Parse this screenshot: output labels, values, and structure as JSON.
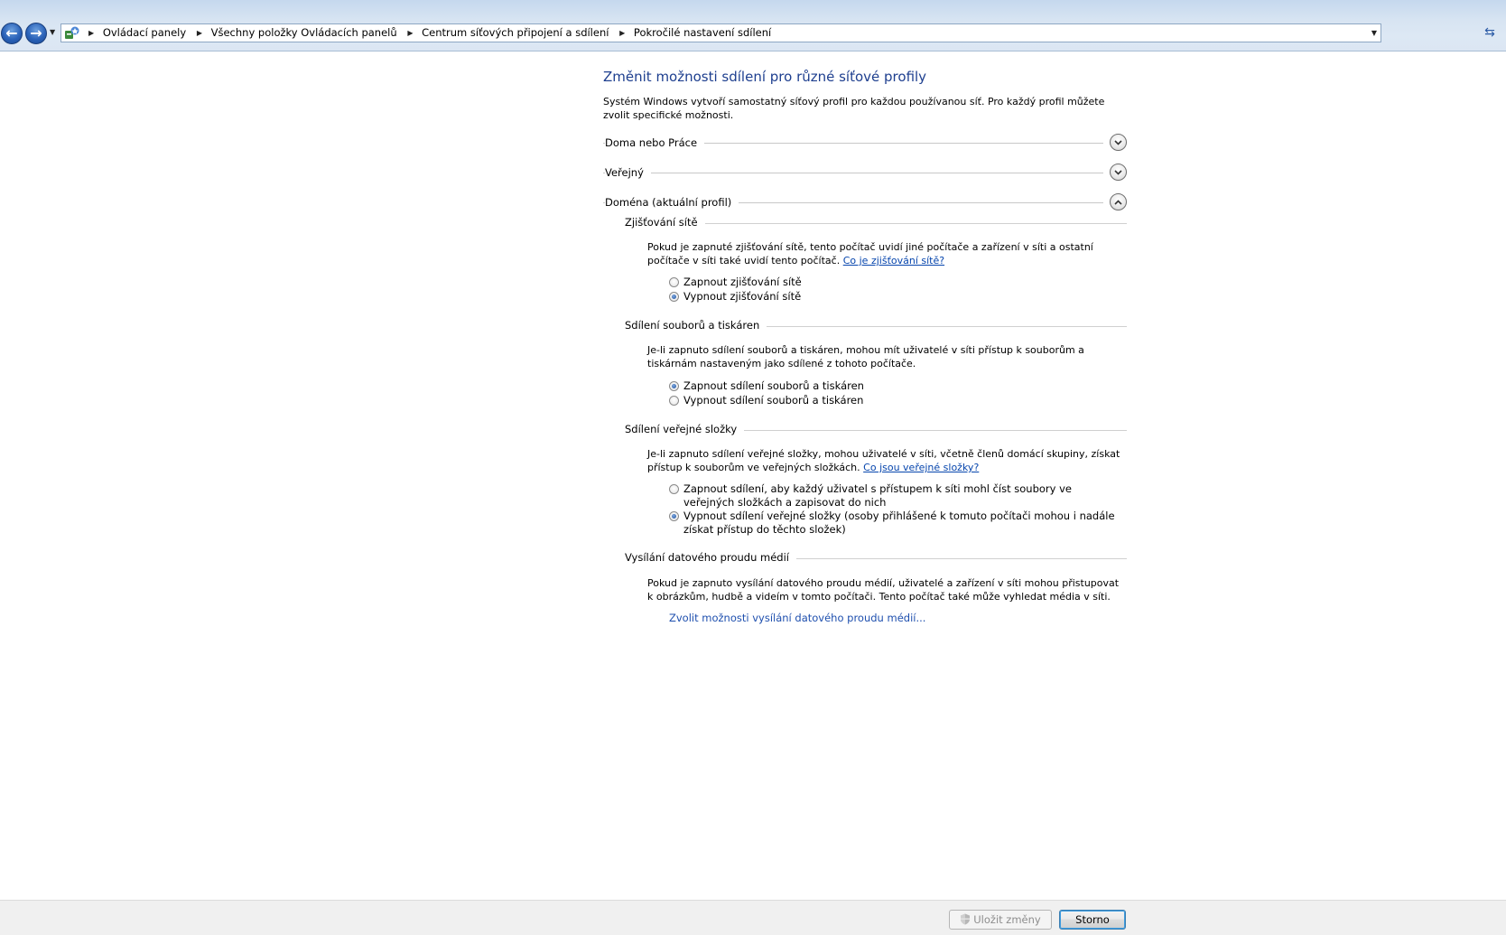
{
  "address_bar": {
    "breadcrumbs": [
      "Ovládací panely",
      "Všechny položky Ovládacích panelů",
      "Centrum síťových připojení a sdílení",
      "Pokročilé nastavení sdílení"
    ]
  },
  "page": {
    "title": "Změnit možnosti sdílení pro různé síťové profily",
    "description": "Systém Windows vytvoří samostatný síťový profil pro každou používanou síť. Pro každý profil můžete zvolit specifické možnosti."
  },
  "profiles": [
    {
      "label": "Doma nebo Práce",
      "expanded": false
    },
    {
      "label": "Veřejný",
      "expanded": false
    },
    {
      "label": "Doména (aktuální profil)",
      "expanded": true
    }
  ],
  "sections": {
    "network_discovery": {
      "heading": "Zjišťování sítě",
      "text": "Pokud je zapnuté zjišťování sítě, tento počítač uvidí jiné počítače a zařízení v síti a ostatní počítače v síti také uvidí tento počítač.",
      "link": "Co je zjišťování sítě?",
      "options": [
        {
          "label": "Zapnout zjišťování sítě",
          "checked": false
        },
        {
          "label": "Vypnout zjišťování sítě",
          "checked": true
        }
      ]
    },
    "file_printer_sharing": {
      "heading": "Sdílení souborů a tiskáren",
      "text": "Je-li zapnuto sdílení souborů a tiskáren, mohou mít uživatelé v síti přístup k souborům a tiskárnám nastaveným jako sdílené z tohoto počítače.",
      "options": [
        {
          "label": "Zapnout sdílení souborů a tiskáren",
          "checked": true
        },
        {
          "label": "Vypnout sdílení souborů a tiskáren",
          "checked": false
        }
      ]
    },
    "public_folder_sharing": {
      "heading": "Sdílení veřejné složky",
      "text": "Je-li zapnuto sdílení veřejné složky, mohou uživatelé v síti, včetně členů domácí skupiny, získat přístup k souborům ve veřejných složkách.",
      "link": "Co jsou veřejné složky?",
      "options": [
        {
          "label": "Zapnout sdílení, aby každý uživatel s přístupem k síti mohl číst soubory ve veřejných složkách a zapisovat do nich",
          "checked": false
        },
        {
          "label": "Vypnout sdílení veřejné složky (osoby přihlášené k tomuto počítači mohou i nadále získat přístup do těchto složek)",
          "checked": true
        }
      ]
    },
    "media_streaming": {
      "heading": "Vysílání datového proudu médií",
      "text": "Pokud je zapnuto vysílání datového proudu médií, uživatelé a zařízení v síti mohou přistupovat k obrázkům, hudbě a videím v tomto počítači. Tento počítač také může vyhledat média v síti.",
      "link": "Zvolit možnosti vysílání datového proudu médií..."
    }
  },
  "footer": {
    "save_label": "Uložit změny",
    "cancel_label": "Storno"
  },
  "colors": {
    "title": "#1e3f8f",
    "link": "#0645ad",
    "toolbar": "#d7e4f2"
  }
}
